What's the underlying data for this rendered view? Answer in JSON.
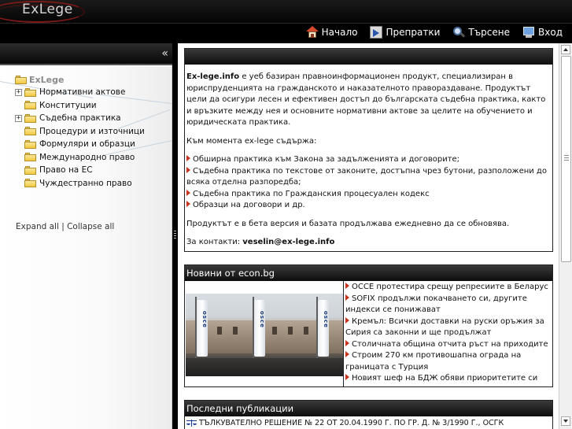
{
  "header": {
    "logo_text": "ExLege"
  },
  "nav": {
    "items": [
      {
        "label": "Начало",
        "icon": "home-icon"
      },
      {
        "label": "Препратки",
        "icon": "links-icon"
      },
      {
        "label": "Търсене",
        "icon": "search-icon"
      },
      {
        "label": "Вход",
        "icon": "login-icon"
      }
    ]
  },
  "sidebar": {
    "collapse_glyph": "«",
    "tree": {
      "root": "ExLege",
      "items": [
        {
          "label": "Нормативни актове",
          "expandable": true
        },
        {
          "label": "Конституции",
          "expandable": false
        },
        {
          "label": "Съдебна практика",
          "expandable": true
        },
        {
          "label": "Процедури и източници",
          "expandable": false
        },
        {
          "label": "Формуляри и образци",
          "expandable": false
        },
        {
          "label": "Международно право",
          "expandable": false
        },
        {
          "label": "Право на ЕС",
          "expandable": false
        },
        {
          "label": "Чуждестранно право",
          "expandable": false
        }
      ]
    },
    "expand_all": "Expand all",
    "separator": " | ",
    "collapse_all": "Collapse all"
  },
  "intro": {
    "title": "",
    "p1_bold": "Ex-lege.info",
    "p1_rest": " е уеб базиран правноинформационен продукт, специализиран в юриспруденцията на гражданското и наказателното правораздаване. Продуктът цели да осигури лесен и ефективен достъп до българската съдебна практика, както и връзките между нея и основните нормативни актове за целите на обучението и юридическата практика.",
    "p2": "Към момента ex-lege съдържа:",
    "bullets": [
      "Обширна практика към Закона за задълженията и договорите;",
      "Съдебна практика по текстове от законите, достъпна чрез бутони, разположени до всяка отделна разпоредба;",
      "Съдебна практика по Гражданския процесуален кодекс",
      "Образци на договори и др."
    ],
    "p3": "Продуктът е в бета версия и базата продължава ежедневно да се обновява.",
    "contact_label": "За контакти: ",
    "contact_email": "veselin@ex-lege.info"
  },
  "news": {
    "title": "Новини от econ.bg",
    "image_flag_text": "osce",
    "items": [
      "ОССЕ протестира срещу репресиите в Беларус",
      "SOFIX продължи покачването си, другите индекси се понижават",
      "Кремъл: Всички доставки на руски оръжия за Сирия са законни и ще продължат",
      "Столичната община отчита ръст на приходите",
      "Строим 270 км противошапна ограда на границата с Турция",
      "Новият шеф на БДЖ обяви приоритетите си"
    ]
  },
  "publications": {
    "title": "Последни публикации",
    "items": [
      "ТЪЛКУВАТЕЛНО РЕШЕНИЕ № 22 ОТ 20.04.1990 Г. ПО ГР. Д. № 3/1990 Г., ОСГК"
    ]
  },
  "colors": {
    "bullet": "#c8341e",
    "header_bg": "#0d0d0d",
    "logo_swoosh": "#b82a22"
  }
}
